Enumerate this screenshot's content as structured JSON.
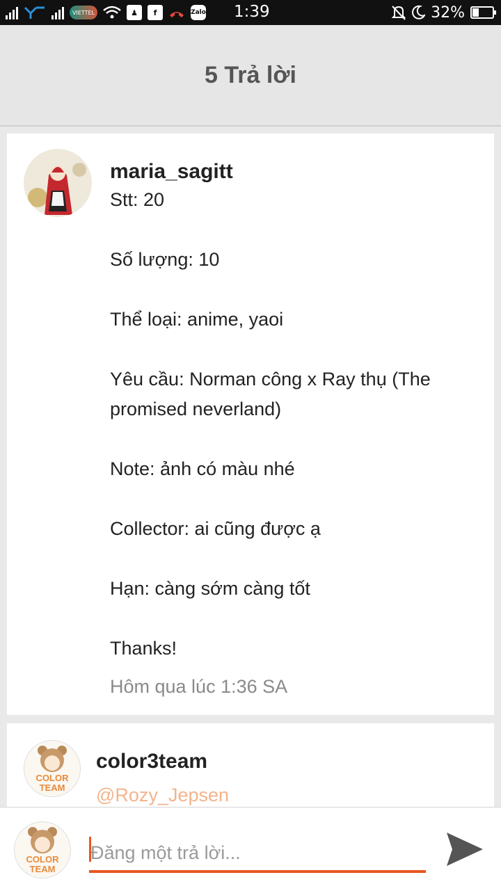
{
  "status_bar": {
    "time": "1:39",
    "battery": "32%",
    "battery_level": 0.32,
    "app_icons": [
      "signal-icon",
      "network-icon",
      "signal-icon",
      "carrier-icon",
      "wifi-icon",
      "notification-icon",
      "facebook-icon",
      "missed-call-icon",
      "zalo-icon"
    ],
    "carrier_text": "VIETTEL",
    "zalo_text": "Zalo",
    "fb_text": "f"
  },
  "header": {
    "title": "5 Trả lời"
  },
  "replies": [
    {
      "username": "maria_sagitt",
      "lines": [
        "Stt: 20",
        "Số lượng: 10",
        "Thể loại: anime, yaoi",
        "Yêu cầu: Norman công x Ray thụ (The promised neverland)",
        "Note: ảnh có màu nhé",
        "Collector: ai cũng được ạ",
        "Hạn: càng sớm càng tốt",
        "Thanks!"
      ],
      "timestamp": "Hôm qua lúc 1:36 SA"
    },
    {
      "username": "color3team",
      "mention": "@Rozy_Jepsen",
      "avatar_text_1": "COLOR",
      "avatar_text_2": "TEAM"
    }
  ],
  "composer": {
    "placeholder": "Đăng một trả lời...",
    "avatar_text_1": "COLOR",
    "avatar_text_2": "TEAM"
  },
  "colors": {
    "accent": "#e8561f",
    "mention": "#f3b48c",
    "header_bg": "#e6e6e6"
  }
}
